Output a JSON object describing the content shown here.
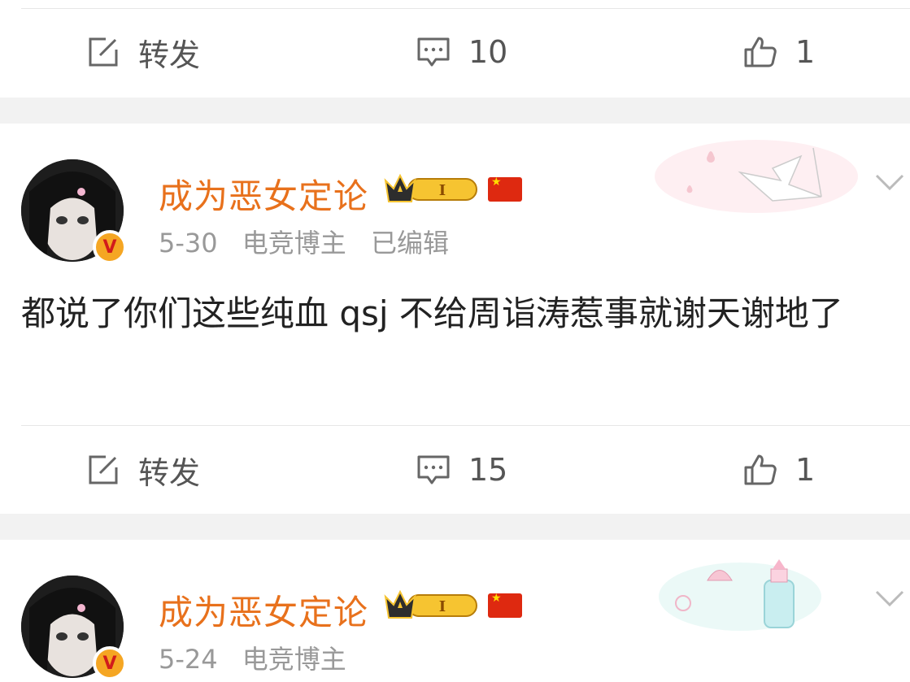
{
  "top_actions": {
    "repost_label": "转发",
    "comment_count": "10",
    "like_count": "1"
  },
  "posts": [
    {
      "username": "成为恶女定论",
      "date": "5-30",
      "tag": "电竞博主",
      "edited": "已编辑",
      "badge_level": "I",
      "text": "都说了你们这些纯血 qsj 不给周诣涛惹事就谢天谢地了",
      "verified_mark": "V",
      "actions": {
        "repost_label": "转发",
        "comment_count": "15",
        "like_count": "1"
      }
    },
    {
      "username": "成为恶女定论",
      "date": "5-24",
      "tag": "电竞博主",
      "badge_level": "I",
      "verified_mark": "V"
    }
  ],
  "icons": {
    "repost": "edit-square-icon",
    "comment": "comment-bubble-icon",
    "like": "thumbs-up-icon",
    "more": "chevron-down-icon"
  },
  "colors": {
    "username": "#e8711c",
    "meta": "#999999",
    "background": "#f2f2f2",
    "verified": "#f5a623"
  }
}
